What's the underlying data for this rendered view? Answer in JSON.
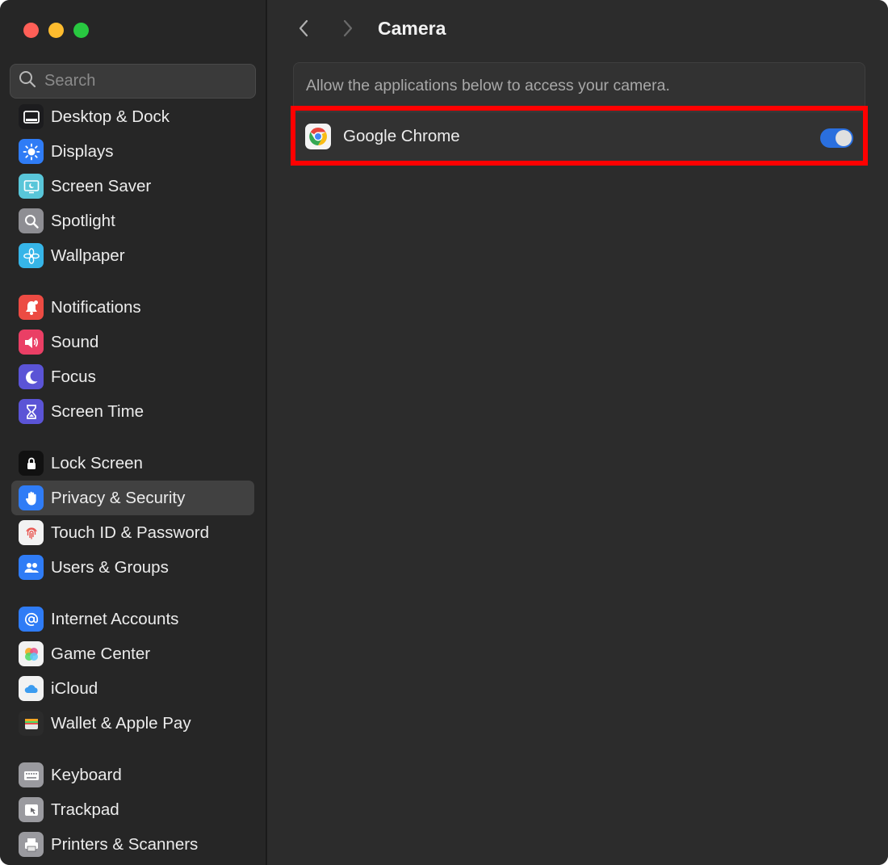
{
  "window": {
    "traffic_lights": [
      "close",
      "minimize",
      "zoom"
    ]
  },
  "sidebar": {
    "search_placeholder": "Search",
    "items": [
      {
        "label": "Desktop & Dock",
        "icon": "dock-icon",
        "color": "#1c1c1e"
      },
      {
        "label": "Displays",
        "icon": "sun-icon",
        "color": "#2f7cf6"
      },
      {
        "label": "Screen Saver",
        "icon": "screen-saver-icon",
        "color": "#59c6d9"
      },
      {
        "label": "Spotlight",
        "icon": "magnifier-icon",
        "color": "#8e8e93"
      },
      {
        "label": "Wallpaper",
        "icon": "flower-icon",
        "color": "#36b5e8"
      },
      {
        "label": "Notifications",
        "icon": "bell-icon",
        "color": "#ec4b43"
      },
      {
        "label": "Sound",
        "icon": "speaker-icon",
        "color": "#ea3f65"
      },
      {
        "label": "Focus",
        "icon": "moon-icon",
        "color": "#5b54d6"
      },
      {
        "label": "Screen Time",
        "icon": "hourglass-icon",
        "color": "#5b54d6"
      },
      {
        "label": "Lock Screen",
        "icon": "lock-icon",
        "color": "#111111"
      },
      {
        "label": "Privacy & Security",
        "icon": "hand-icon",
        "color": "#2f7cf6"
      },
      {
        "label": "Touch ID & Password",
        "icon": "fingerprint-icon",
        "color": "#f2f2f2"
      },
      {
        "label": "Users & Groups",
        "icon": "users-icon",
        "color": "#2f7cf6"
      },
      {
        "label": "Internet Accounts",
        "icon": "at-icon",
        "color": "#2f7cf6"
      },
      {
        "label": "Game Center",
        "icon": "game-center-icon",
        "color": "#f2f2f2"
      },
      {
        "label": "iCloud",
        "icon": "cloud-icon",
        "color": "#f2f2f2"
      },
      {
        "label": "Wallet & Apple Pay",
        "icon": "wallet-icon",
        "color": "#2b2b2b"
      },
      {
        "label": "Keyboard",
        "icon": "keyboard-icon",
        "color": "#9a9a9f"
      },
      {
        "label": "Trackpad",
        "icon": "trackpad-icon",
        "color": "#9a9a9f"
      },
      {
        "label": "Printers & Scanners",
        "icon": "printer-icon",
        "color": "#9a9a9f"
      }
    ],
    "selected": "Privacy & Security"
  },
  "main": {
    "title": "Camera",
    "description": "Allow the applications below to access your camera.",
    "apps": [
      {
        "name": "Google Chrome",
        "icon": "chrome-icon",
        "enabled": true
      }
    ]
  },
  "colors": {
    "accent": "#2a6fde",
    "highlight": "#ff0000"
  }
}
